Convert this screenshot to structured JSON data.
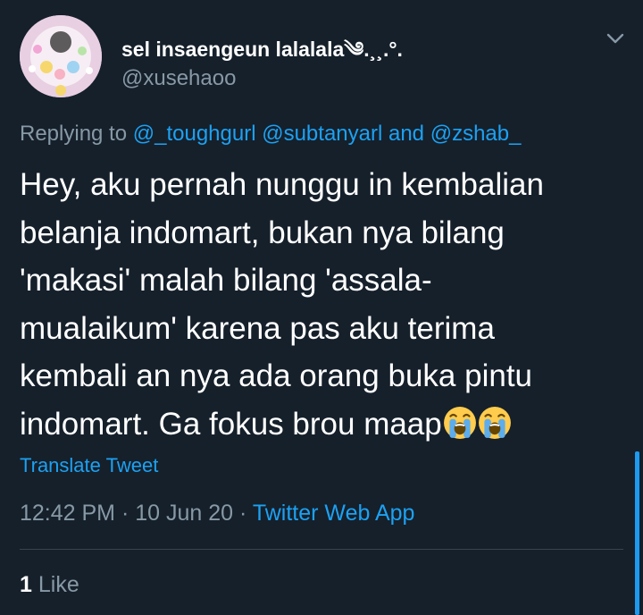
{
  "user": {
    "display_name": "sel insaengeun lalalala༄.¸¸.°.",
    "handle": "@xusehaoo",
    "avatar_icon": "profile-avatar"
  },
  "header": {
    "more_icon": "chevron-down-icon"
  },
  "reply": {
    "prefix": "Replying to",
    "mention_1": "@_toughgurl",
    "mention_2": "@subtanyarl",
    "connector": "and",
    "mention_3": "@zshab_"
  },
  "tweet": {
    "lines": [
      "Hey, aku pernah nunggu in kembalian",
      "belanja indomart, bukan nya bilang",
      "'makasi' malah bilang 'assala-",
      "mualaikum' karena pas aku terima",
      "kembali an nya ada orang buka pintu",
      "indomart. Ga fokus brou maap"
    ],
    "emoji": [
      "loudly-crying-face-icon",
      "loudly-crying-face-icon"
    ]
  },
  "translate_label": "Translate Tweet",
  "meta": {
    "time": "12:42 PM",
    "separator": "·",
    "date": "10 Jun 20",
    "source": "Twitter Web App"
  },
  "likes": {
    "count": "1",
    "label": "Like"
  },
  "colors": {
    "background": "#15202b",
    "text": "#ffffff",
    "secondary": "#8899a6",
    "accent": "#1da1f2",
    "divider": "#38444d"
  }
}
